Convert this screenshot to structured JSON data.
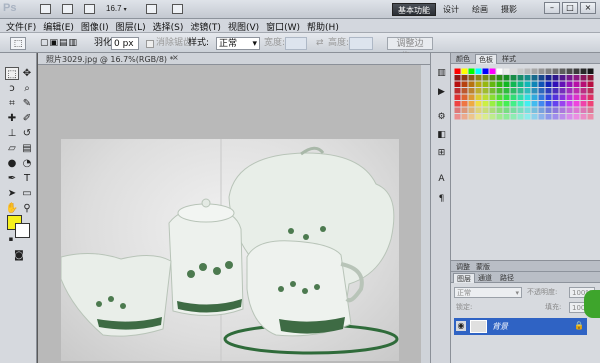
{
  "appbar": {
    "logo": "Ps",
    "zoom": "16.7",
    "workspace_active": "基本功能",
    "workspace_links": [
      "设计",
      "绘画",
      "摄影"
    ]
  },
  "menu": [
    "文件(F)",
    "编辑(E)",
    "图像(I)",
    "图层(L)",
    "选择(S)",
    "滤镜(T)",
    "视图(V)",
    "窗口(W)",
    "帮助(H)"
  ],
  "options": {
    "feather_label": "羽化:",
    "feather_value": "0 px",
    "antialias_label": "消除锯齿",
    "style_label": "样式:",
    "style_value": "正常",
    "width_label": "宽度:",
    "height_label": "高度:",
    "refine_edge": "调整边缘..."
  },
  "document": {
    "tab_title": "照片3029.jpg @ 16.7%(RGB/8) *",
    "close": "×"
  },
  "swatches_panel": {
    "tabs": [
      "颜色",
      "色板",
      "样式"
    ],
    "active_tab": "色板"
  },
  "layers_panel": {
    "tabs": [
      "图层",
      "通道",
      "路径"
    ],
    "active_tab": "图层",
    "blend_mode": "正常",
    "opacity_label": "不透明度:",
    "opacity_value": "100%",
    "lock_label": "锁定:",
    "fill_label": "填充:",
    "fill_value": "100%",
    "layer_name": "背景"
  },
  "colors": {
    "foreground": "#f7f11d",
    "background": "#ffffff",
    "layer_highlight": "#2f63c4"
  }
}
